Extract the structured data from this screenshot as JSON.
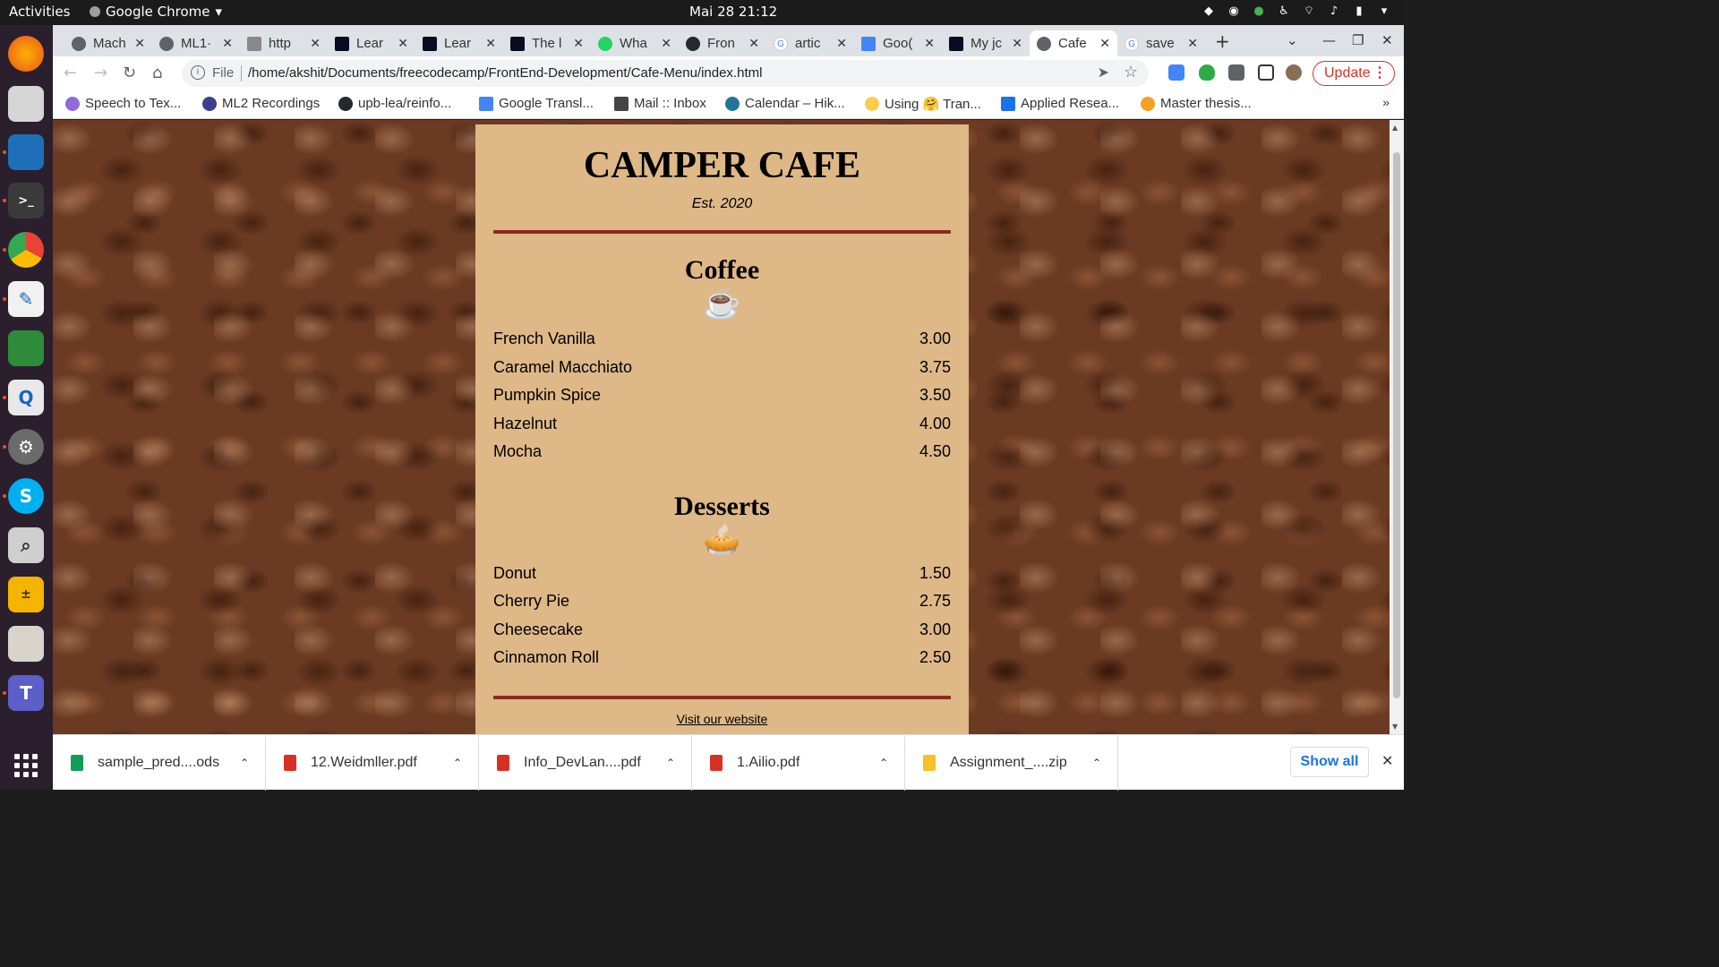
{
  "topbar": {
    "activities": "Activities",
    "app_name": "Google Chrome",
    "app_caret": "▾",
    "clock": "Mai 28  21:12"
  },
  "tabs": [
    {
      "label": "Mach"
    },
    {
      "label": "ML1·"
    },
    {
      "label": "http"
    },
    {
      "label": "Lear"
    },
    {
      "label": "Lear"
    },
    {
      "label": "The l"
    },
    {
      "label": "Wha"
    },
    {
      "label": "Fron"
    },
    {
      "label": "artic"
    },
    {
      "label": "Goo("
    },
    {
      "label": "My jc"
    },
    {
      "label": "Cafe",
      "active": true
    },
    {
      "label": "save"
    }
  ],
  "omnibox": {
    "scheme": "File",
    "url": "/home/akshit/Documents/freecodecamp/FrontEnd-Development/Cafe-Menu/index.html"
  },
  "update_button": "Update",
  "bookmarks": [
    {
      "label": "Speech to Tex...",
      "color": "#8e6bd8"
    },
    {
      "label": "ML2 Recordings",
      "color": "#3b3f8f"
    },
    {
      "label": "upb-lea/reinfo...",
      "color": "#24292f"
    },
    {
      "label": "Google Transl...",
      "color": "#4285f4"
    },
    {
      "label": "Mail :: Inbox",
      "color": "#444444"
    },
    {
      "label": "Calendar – Hik...",
      "color": "#21759b"
    },
    {
      "label": "Using 🤗 Tran...",
      "color": "#ffcc4d"
    },
    {
      "label": "Applied Resea...",
      "color": "#1a73e8"
    },
    {
      "label": "Master thesis...",
      "color": "#f4a020"
    }
  ],
  "menu": {
    "title": "CAMPER CAFE",
    "established": "Est. 2020",
    "coffee": {
      "heading": "Coffee",
      "icon": "☕",
      "items": [
        {
          "name": "French Vanilla",
          "price": "3.00"
        },
        {
          "name": "Caramel Macchiato",
          "price": "3.75"
        },
        {
          "name": "Pumpkin Spice",
          "price": "3.50"
        },
        {
          "name": "Hazelnut",
          "price": "4.00"
        },
        {
          "name": "Mocha",
          "price": "4.50"
        }
      ]
    },
    "desserts": {
      "heading": "Desserts",
      "icon": "🥧",
      "items": [
        {
          "name": "Donut",
          "price": "1.50"
        },
        {
          "name": "Cherry Pie",
          "price": "2.75"
        },
        {
          "name": "Cheesecake",
          "price": "3.00"
        },
        {
          "name": "Cinnamon Roll",
          "price": "2.50"
        }
      ]
    },
    "footer_link": "Visit our website"
  },
  "downloads": [
    {
      "name": "sample_pred....ods",
      "color": "#0f9d58"
    },
    {
      "name": "12.Weidmller.pdf",
      "color": "#d93025"
    },
    {
      "name": "Info_DevLan....pdf",
      "color": "#d93025"
    },
    {
      "name": "1.Ailio.pdf",
      "color": "#d93025"
    },
    {
      "name": "Assignment_....zip",
      "color": "#f6c026"
    }
  ],
  "show_all": "Show all",
  "colors": {
    "menu_bg": "#deb887",
    "divider": "#8b2a22",
    "dock_bg": "#2b1f2e",
    "update_red": "#d93025"
  }
}
